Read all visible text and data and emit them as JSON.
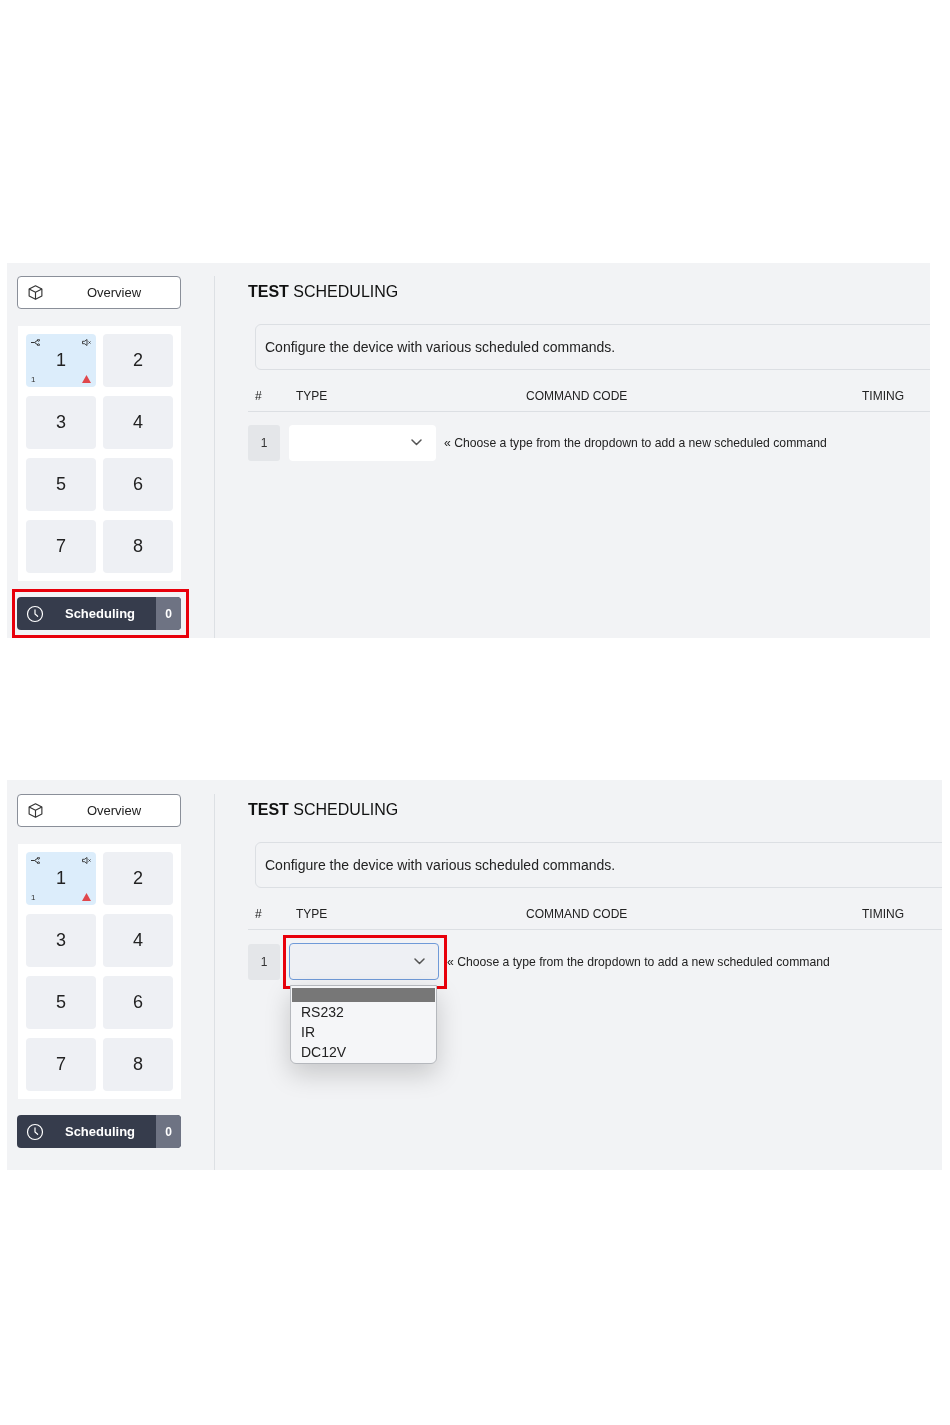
{
  "panels": [
    {
      "sidebar": {
        "overview": {
          "label": "Overview"
        },
        "tiles": [
          {
            "label": "1",
            "selected": true,
            "indicators": true,
            "sub_label": "1",
            "warning": true
          },
          {
            "label": "2",
            "selected": false,
            "indicators": false,
            "warning": false
          },
          {
            "label": "3",
            "selected": false,
            "indicators": false,
            "warning": false
          },
          {
            "label": "4",
            "selected": false,
            "indicators": false,
            "warning": false
          },
          {
            "label": "5",
            "selected": false,
            "indicators": false,
            "warning": false
          },
          {
            "label": "6",
            "selected": false,
            "indicators": false,
            "warning": false
          },
          {
            "label": "7",
            "selected": false,
            "indicators": false,
            "warning": false
          },
          {
            "label": "8",
            "selected": false,
            "indicators": false,
            "warning": false
          }
        ],
        "scheduling": {
          "label": "Scheduling",
          "count": "0",
          "highlighted": true
        }
      },
      "main": {
        "title": "**TEST** SCHEDULING",
        "description": "Configure the device with various scheduled commands.",
        "columns": [
          "#",
          "TYPE",
          "COMMAND CODE",
          "TIMING"
        ],
        "rows": [
          {
            "index": "1",
            "type_select": {
              "highlighted": false,
              "focused": false,
              "open": false
            },
            "hint": "« Choose a type from the dropdown to add a new scheduled command"
          }
        ]
      }
    },
    {
      "sidebar": {
        "overview": {
          "label": "Overview"
        },
        "tiles": [
          {
            "label": "1",
            "selected": true,
            "indicators": true,
            "sub_label": "1",
            "warning": true
          },
          {
            "label": "2",
            "selected": false,
            "indicators": false,
            "warning": false
          },
          {
            "label": "3",
            "selected": false,
            "indicators": false,
            "warning": false
          },
          {
            "label": "4",
            "selected": false,
            "indicators": false,
            "warning": false
          },
          {
            "label": "5",
            "selected": false,
            "indicators": false,
            "warning": false
          },
          {
            "label": "6",
            "selected": false,
            "indicators": false,
            "warning": false
          },
          {
            "label": "7",
            "selected": false,
            "indicators": false,
            "warning": false
          },
          {
            "label": "8",
            "selected": false,
            "indicators": false,
            "warning": false
          }
        ],
        "scheduling": {
          "label": "Scheduling",
          "count": "0",
          "highlighted": false
        }
      },
      "main": {
        "title": "**TEST** SCHEDULING",
        "description": "Configure the device with various scheduled commands.",
        "columns": [
          "#",
          "TYPE",
          "COMMAND CODE",
          "TIMING"
        ],
        "rows": [
          {
            "index": "1",
            "type_select": {
              "highlighted": true,
              "focused": true,
              "open": true,
              "blank_option_selected": true,
              "options": [
                {
                  "label": "RS232",
                  "selected": false
                },
                {
                  "label": "IR",
                  "selected": false
                },
                {
                  "label": "DC12V",
                  "selected": false
                }
              ]
            },
            "hint": "« Choose a type from the dropdown to add a new scheduled command"
          }
        ]
      }
    }
  ]
}
